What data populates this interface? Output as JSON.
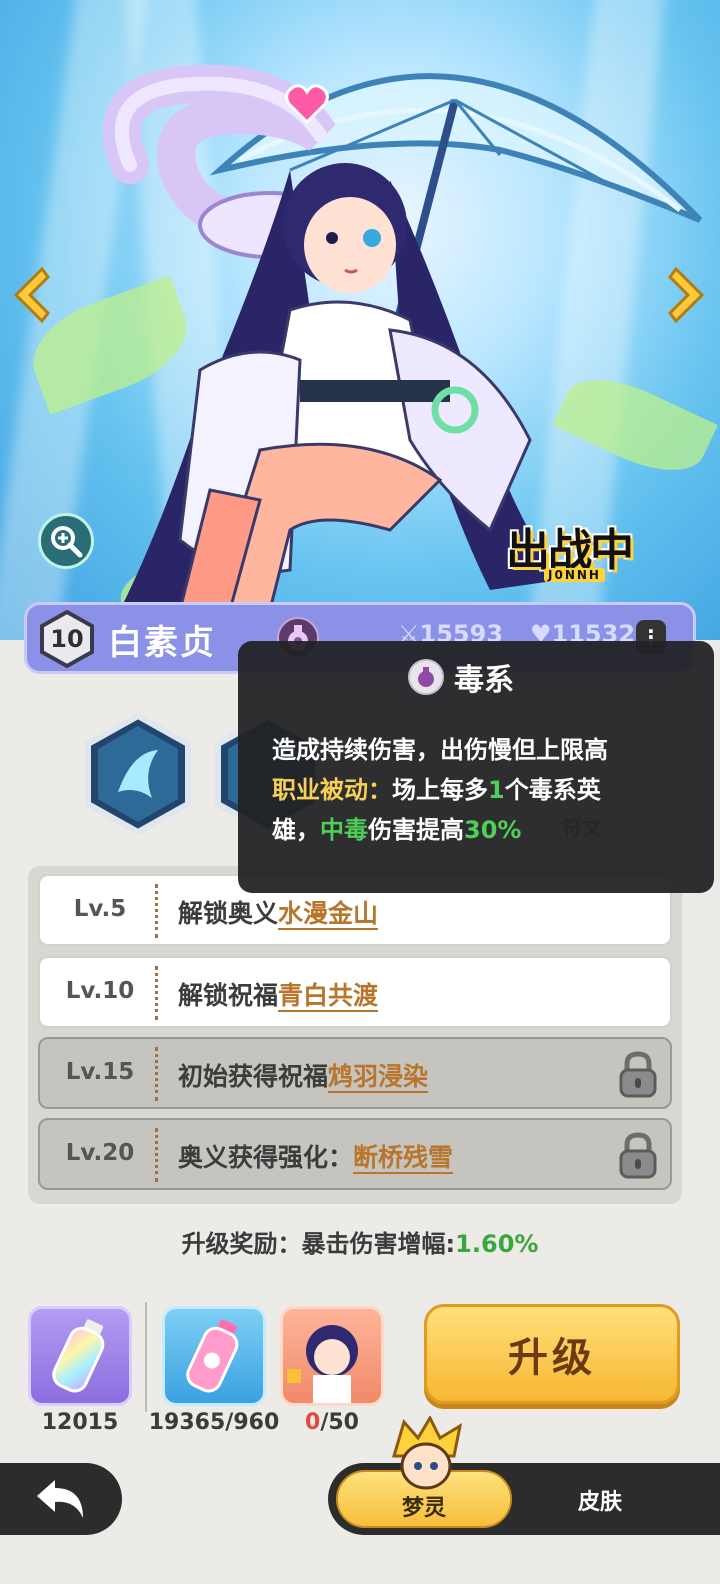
{
  "hero": {
    "name": "白素贞",
    "level": "10",
    "attack": "15593",
    "hp": "115322",
    "status_badge": "出战中",
    "status_badge_sub": "J0NNH"
  },
  "tooltip": {
    "title": "毒系",
    "line1": "造成持续伤害，出伤慢但上限高",
    "line2_label": "职业被动：",
    "line2_text_a": "场上每多",
    "line2_count": "1",
    "line2_text_b": "个毒系英",
    "line3_text_a": "雄，",
    "line3_highlight": "中毒",
    "line3_text_b": "伤害提高",
    "line3_percent": "30%"
  },
  "skills": {
    "rune_label": "符文"
  },
  "unlocks": [
    {
      "level": "Lv.5",
      "text": "解锁奥义",
      "highlight": "水漫金山",
      "locked": false
    },
    {
      "level": "Lv.10",
      "text": "解锁祝福",
      "highlight": "青白共渡",
      "locked": false
    },
    {
      "level": "Lv.15",
      "text": "初始获得祝福",
      "highlight": "鸩羽浸染",
      "locked": true
    },
    {
      "level": "Lv.20",
      "text": "奥义获得强化：",
      "highlight": "断桥残雪",
      "locked": true
    }
  ],
  "reward": {
    "label": "升级奖励：暴击伤害增幅:",
    "value": "1.60%"
  },
  "items": {
    "rainbow_potion_count": "12015",
    "pink_potion_count": "19365/960",
    "shard_have": "0",
    "shard_need": "/50"
  },
  "buttons": {
    "upgrade": "升级"
  },
  "tabs": {
    "active": "梦灵",
    "skin": "皮肤"
  },
  "colors": {
    "accent_green": "#4fcf57",
    "accent_yellow": "#f6d057",
    "name_bar": "#8a91e6",
    "upgrade": "#f7b733"
  }
}
